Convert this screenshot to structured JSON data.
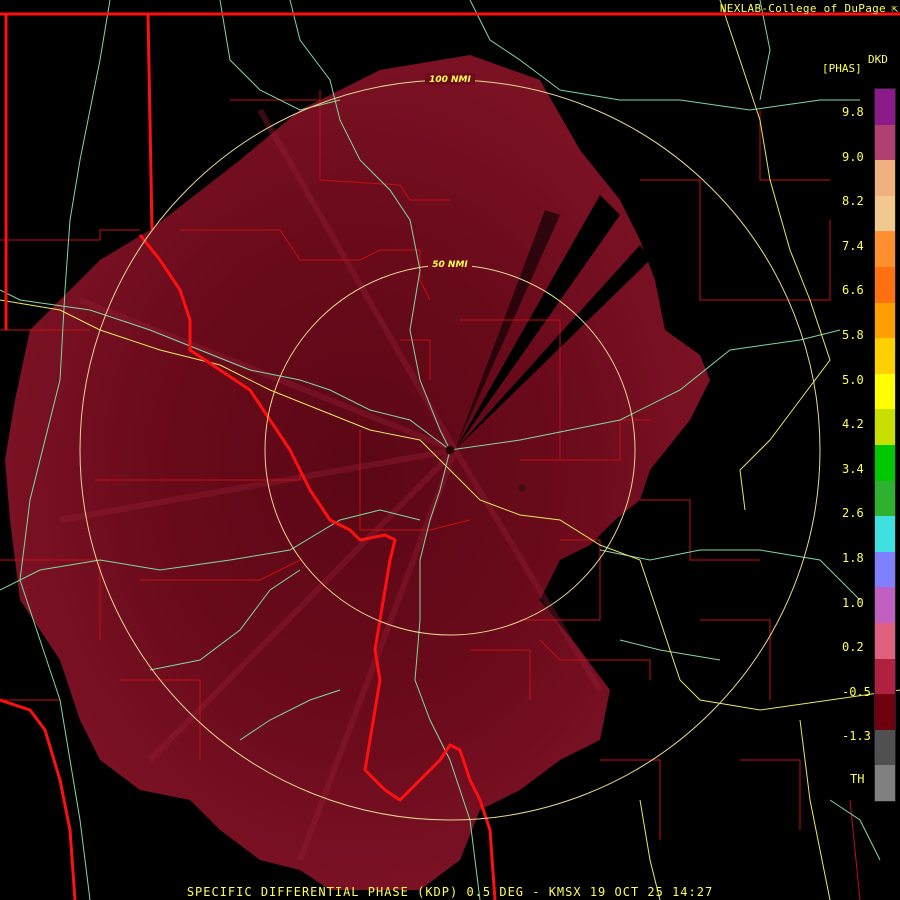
{
  "credit": "NEXLAB-College of DuPage",
  "credit_icon": "arrow-icon",
  "legend": {
    "product": "DKD",
    "units": "[PHAS]",
    "ticks": [
      "9.8",
      "9.0",
      "8.2",
      "7.4",
      "6.6",
      "5.8",
      "5.0",
      "4.2",
      "3.4",
      "2.6",
      "1.8",
      "1.0",
      "0.2",
      "-0.5",
      "-1.3",
      "TH"
    ],
    "colors": [
      "#8b1a8b",
      "#b04070",
      "#f0b080",
      "#f0c890",
      "#ff9030",
      "#ff7010",
      "#ffa000",
      "#ffd000",
      "#ffff00",
      "#c8e000",
      "#00c800",
      "#30b030",
      "#40e0e0",
      "#8080ff",
      "#c060c0",
      "#e06080",
      "#b02040",
      "#700010",
      "#505050",
      "#808080"
    ]
  },
  "rings": [
    {
      "label": "100 NMI"
    },
    {
      "label": "50 NMI"
    }
  ],
  "footer": "SPECIFIC DIFFERENTIAL PHASE (KDP) 0.5 DEG - KMSX 19 OCT 25 14:27",
  "colors": {
    "echo": "#6e0b1c",
    "echo_light": "#8a1a30",
    "state_border": "#ff1010",
    "county_border": "#c41010",
    "river": "#7fd9a0",
    "highway": "#e8e860",
    "ring": "#e8d890",
    "text": "#ffff55"
  }
}
